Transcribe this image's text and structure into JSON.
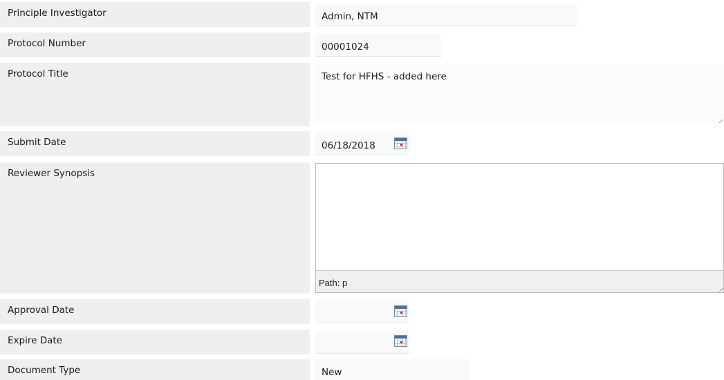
{
  "fields": {
    "principal_investigator": {
      "label": "Principle Investigator",
      "value": "Admin, NTM"
    },
    "protocol_number": {
      "label": "Protocol Number",
      "value": "00001024"
    },
    "protocol_title": {
      "label": "Protocol Title",
      "value": "Test for HFHS - added here"
    },
    "submit_date": {
      "label": "Submit Date",
      "value": "06/18/2018",
      "icon": "calendar-icon"
    },
    "reviewer_synopsis": {
      "label": "Reviewer Synopsis",
      "value": "",
      "path_text": "Path: p"
    },
    "approval_date": {
      "label": "Approval Date",
      "value": "",
      "icon": "calendar-icon"
    },
    "expire_date": {
      "label": "Expire Date",
      "value": "",
      "icon": "calendar-icon"
    },
    "document_type": {
      "label": "Document Type",
      "value": "New"
    }
  },
  "colors": {
    "label_bg": "#efefef",
    "field_bg": "#f8fafa",
    "calendar_header": "#4f6ea8"
  }
}
